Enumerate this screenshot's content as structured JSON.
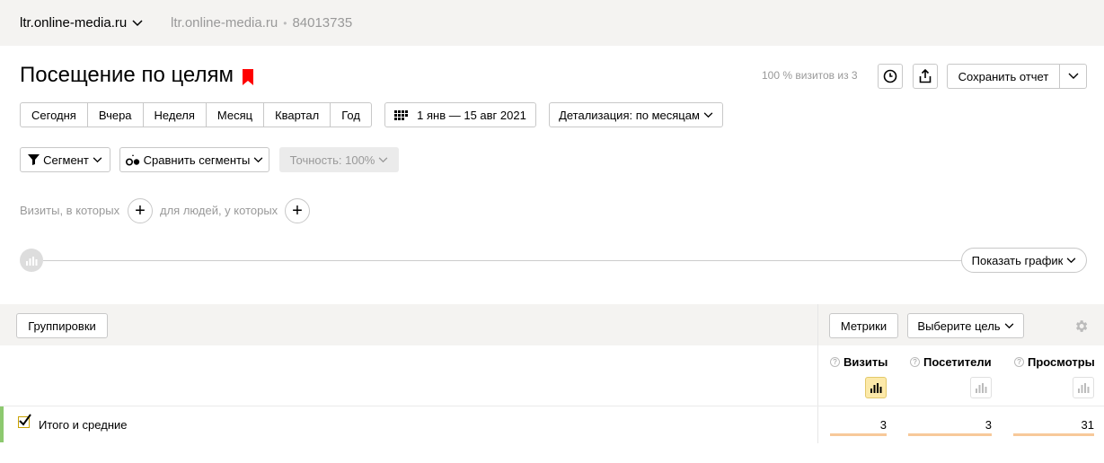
{
  "header": {
    "site_name": "ltr.online-media.ru",
    "breadcrumb_site": "ltr.online-media.ru",
    "breadcrumb_sep": "•",
    "counter_id": "84013735"
  },
  "report": {
    "title": "Посещение по целям",
    "sample_text": "100 % визитов из 3",
    "save_label": "Сохранить отчет"
  },
  "periods": [
    "Сегодня",
    "Вчера",
    "Неделя",
    "Месяц",
    "Квартал",
    "Год"
  ],
  "date_range": "1 янв — 15 авг 2021",
  "detail_label": "Детализация: по месяцам",
  "segment_label": "Сегмент",
  "compare_label": "Сравнить сегменты",
  "accuracy_label": "Точность: 100%",
  "filters": {
    "visits_label": "Визиты, в которых",
    "people_label": "для людей, у которых"
  },
  "show_chart_label": "Показать график",
  "table": {
    "groupings_label": "Группировки",
    "metrics_label": "Метрики",
    "goal_label": "Выберите цель",
    "columns": [
      "Визиты",
      "Посетители",
      "Просмотры"
    ],
    "total_label": "Итого и средние",
    "totals": [
      "3",
      "3",
      "31"
    ]
  },
  "colors": {
    "accent_red": "#ff0000",
    "active_chart_bg": "#fce9a9",
    "bar_color": "#f7c99a",
    "row_accent": "#8dc96f"
  }
}
